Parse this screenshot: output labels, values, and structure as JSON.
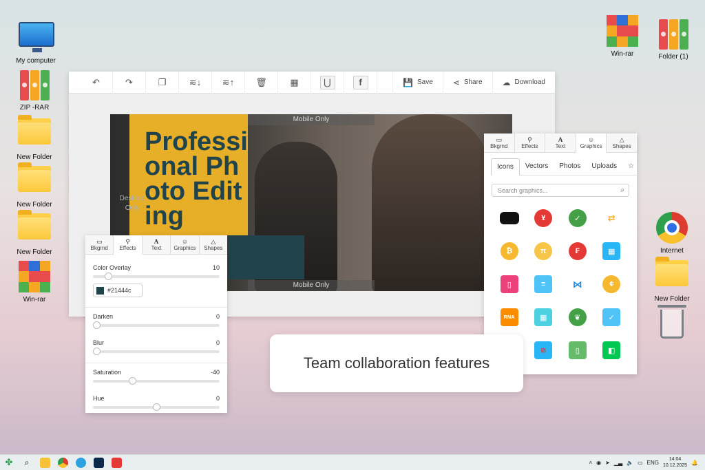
{
  "desktop": {
    "icons_left": [
      {
        "label": "My computer"
      },
      {
        "label": "ZIP -RAR"
      },
      {
        "label": "New Folder"
      },
      {
        "label": "New Folder"
      },
      {
        "label": "New Folder"
      },
      {
        "label": "Win-rar"
      }
    ],
    "icons_right": [
      {
        "label": "Win-rar"
      },
      {
        "label": "Folder (1)"
      },
      {
        "label": "Internet"
      },
      {
        "label": "New Folder"
      }
    ]
  },
  "editor": {
    "toolbar": {
      "save_label": "Save",
      "share_label": "Share",
      "download_label": "Download"
    },
    "canvas": {
      "headline": "Professional Photo Editing",
      "mobile_top": "Mobile Only",
      "mobile_bottom": "Mobile Only",
      "desktop_label": "Desktop Only",
      "right_label": "De"
    }
  },
  "graphics_panel": {
    "tabs": [
      "Bkgrnd",
      "Effects",
      "Text",
      "Graphics",
      "Shapes"
    ],
    "active_tab": "Graphics",
    "subtabs": [
      "Icons",
      "Vectors",
      "Photos",
      "Uploads"
    ],
    "search_placeholder": "Search graphics..."
  },
  "effects_panel": {
    "tabs": [
      "Bkgrnd",
      "Effects",
      "Text",
      "Graphics",
      "Shapes"
    ],
    "active_tab": "Effects",
    "color_overlay": {
      "label": "Color Overlay",
      "value": "10",
      "level": 0.1,
      "color": "#21444c"
    },
    "darken": {
      "label": "Darken",
      "value": "0",
      "level": 0
    },
    "blur": {
      "label": "Blur",
      "value": "0",
      "level": 0
    },
    "saturation": {
      "label": "Saturation",
      "value": "-40",
      "level": 0.3
    },
    "hue": {
      "label": "Hue",
      "value": "0",
      "level": 0.5
    }
  },
  "callout": {
    "text": "Team collaboration features"
  },
  "taskbar": {
    "language": "ENG",
    "time": "14:04",
    "date": "10.12.2025"
  },
  "colors": {
    "accent_yellow": "#e7ae27",
    "accent_teal": "#21444c"
  }
}
